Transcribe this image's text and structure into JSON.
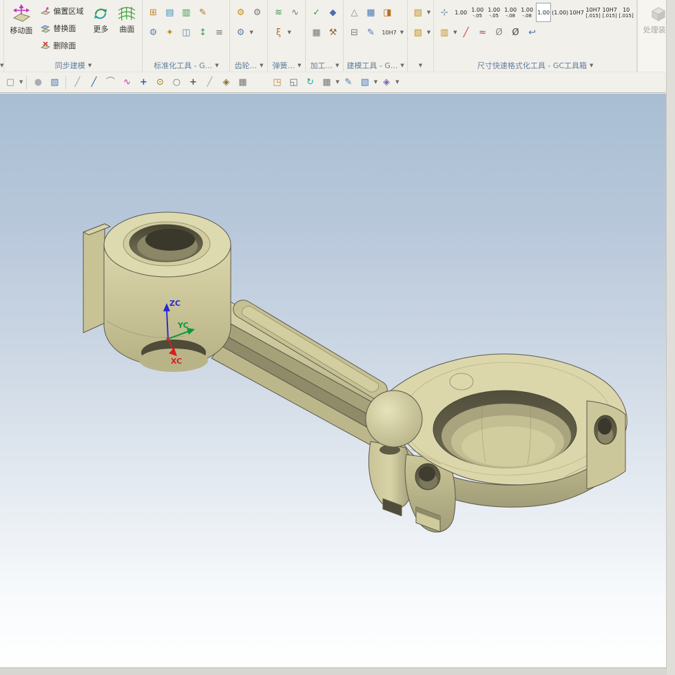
{
  "colors": {
    "ribbon_bg": "#f2f0ea",
    "group_label_text": "#5e7f9e",
    "viewport_top": "#a8bed3",
    "viewport_bottom": "#ffffff",
    "model_body": "#d8d3a7",
    "model_dark": "#8d8968",
    "outline": "#5a584a",
    "axis_x": "#d22020",
    "axis_y": "#0a9a3c",
    "axis_z": "#2a2ad0",
    "disabled_text": "#aaa79e"
  },
  "ribbon": {
    "sync": {
      "move_face": "移动面",
      "offset_region": "偏置区域",
      "replace_face": "替换面",
      "delete_face": "删除面",
      "more": "更多",
      "surface": "曲面",
      "group_label": "同步建模"
    },
    "group_labels": [
      "标准化工具 - G...",
      "齿轮...",
      "弹簧...",
      "加工...",
      "建模工具 - G...",
      "尺寸快速格式化工具 - GC工具箱"
    ],
    "fit_text": "10H7",
    "dim_presets": [
      {
        "top": "1.00",
        "bottom": ""
      },
      {
        "top": "1.00",
        "bottom": "-.05"
      },
      {
        "top": "1.00",
        "bottom": "-.05"
      },
      {
        "top": "1.00",
        "bottom": "-.08"
      },
      {
        "top": "1.00",
        "bottom": "-.08"
      },
      {
        "top": "1.00",
        "bottom": ""
      },
      {
        "top": "(1.00)",
        "bottom": ""
      },
      {
        "top": "10H7",
        "bottom": ""
      },
      {
        "top": "10H7",
        "bottom": "[.015]"
      },
      {
        "top": "10H7",
        "bottom": "[.015]"
      },
      {
        "top": "10",
        "bottom": "[.015]"
      }
    ],
    "process_assembly": "处理装配"
  },
  "icons": {
    "sync_group": [
      "move-face-icon",
      "offset-region-icon",
      "replace-face-icon",
      "delete-face-icon",
      "more-icon",
      "surface-icon"
    ],
    "gc_toolbox_row2": [
      "stack-icon",
      "red-slash-icon",
      "red-approx-icon",
      "diameter-icon",
      "diameter-dark-icon",
      "undo-arrow-icon"
    ],
    "selection_bar": [
      "selection-scope-icon",
      "shaded-object-icon",
      "work-part-cube-icon",
      "line-snap-icon",
      "endpoint-snap-icon",
      "arc-snap-icon",
      "spline-snap-icon",
      "point-snap-icon",
      "center-snap-icon",
      "circle-snap-icon",
      "plus-snap-icon",
      "slash-snap-icon",
      "snap-toggle-icon",
      "grid-snap-icon",
      "window-select-icon",
      "lasso-select-icon",
      "regenerate-icon",
      "grid-display-icon",
      "paint-icon",
      "solid-display-icon",
      "gem-display-icon"
    ],
    "process_assembly": "assembly-cube-icon"
  },
  "viewport": {
    "triad": {
      "x_label": "XC",
      "y_label": "YC",
      "z_label": "ZC"
    }
  }
}
